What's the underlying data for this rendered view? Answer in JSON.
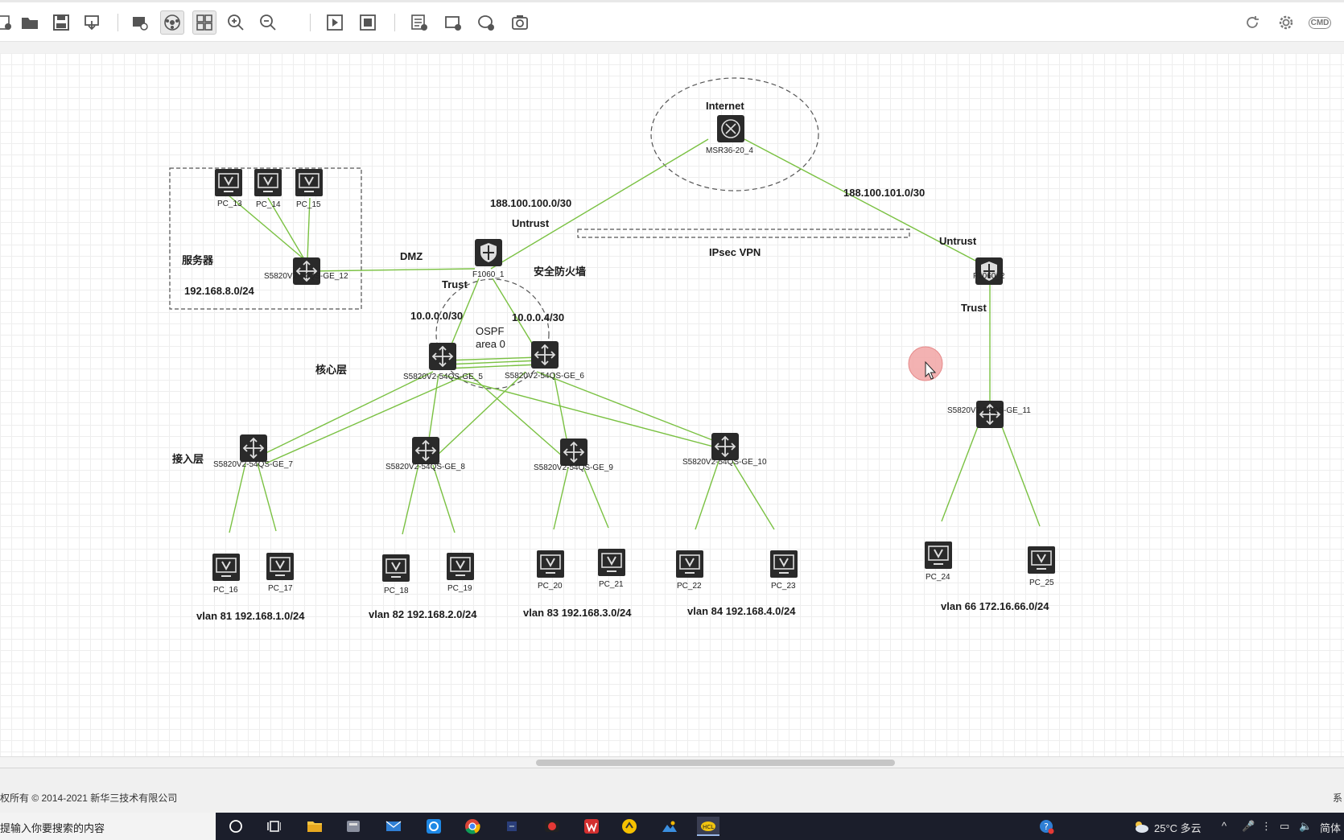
{
  "toolbar": {
    "left_icons": [
      "new-file-icon",
      "open-folder-icon",
      "save-icon",
      "export-icon",
      "capture-icon",
      "topology-icon",
      "grid-view-icon",
      "zoom-in-icon",
      "zoom-out-icon",
      "start-icon",
      "stop-icon",
      "add-note-icon",
      "add-rectangle-icon",
      "add-ellipse-icon",
      "screenshot-icon"
    ],
    "right_icons": [
      "refresh-icon",
      "settings-icon",
      "cmd-icon"
    ],
    "cmd_label": "CMD"
  },
  "topology": {
    "zones": {
      "internet": "Internet",
      "dmz": "DMZ",
      "firewall": "安全防火墙",
      "ipsec": "IPsec VPN",
      "ospf_line1": "OSPF",
      "ospf_line2": "area 0",
      "server": "服务器",
      "server_net": "192.168.8.0/24",
      "core": "核心层",
      "access": "接入层"
    },
    "links": {
      "wan1": "188.100.100.0/30",
      "wan2": "188.100.101.0/30",
      "untrust1": "Untrust",
      "untrust2": "Untrust",
      "trust1": "Trust",
      "trust2": "Trust",
      "p2p1": "10.0.0.0/30",
      "p2p2": "10.0.0.4/30"
    },
    "devices": {
      "msr": "MSR36-20_4",
      "fw1": "F1060_1",
      "fw2": "F1060_2",
      "sw5": "S5820V2-54QS-GE_5",
      "sw6": "S5820V2-54QS-GE_6",
      "sw7": "S5820V2-54QS-GE_7",
      "sw8": "S5820V2-54QS-GE_8",
      "sw9": "S5820V2-54QS-GE_9",
      "sw10": "S5820V2-54QS-GE_10",
      "sw11": "S5820V2-54QS-GE_11",
      "sw12": "S5820V2-54QS-GE_12",
      "pc13": "PC_13",
      "pc14": "PC_14",
      "pc15": "PC_15",
      "pc16": "PC_16",
      "pc17": "PC_17",
      "pc18": "PC_18",
      "pc19": "PC_19",
      "pc20": "PC_20",
      "pc21": "PC_21",
      "pc22": "PC_22",
      "pc23": "PC_23",
      "pc24": "PC_24",
      "pc25": "PC_25"
    },
    "vlans": {
      "v81": "vlan 81 192.168.1.0/24",
      "v82": "vlan 82 192.168.2.0/24",
      "v83": "vlan 83 192.168.3.0/24",
      "v84": "vlan 84 192.168.4.0/24",
      "v66": "vlan 66 172.16.66.0/24"
    }
  },
  "footer": {
    "copyright": "权所有 © 2014-2021 新华三技术有限公司",
    "right_text": "系"
  },
  "taskbar": {
    "search_placeholder": "在这里输入你要搜索的内容",
    "search_visible": "提输入你要搜索的内容",
    "apps": [
      "cortana-icon",
      "task-view-icon",
      "file-explorer-icon",
      "app-icon",
      "mail-icon",
      "edge-icon",
      "chrome-icon",
      "app-icon-2",
      "record-icon",
      "wps-icon",
      "app-icon-3",
      "photos-icon",
      "hcl-icon"
    ],
    "weather": "25°C 多云",
    "ime": "简体"
  },
  "colors": {
    "link": "#7ac142",
    "device_bg": "#2a2a2a",
    "taskbar": "#1b1e2b"
  }
}
